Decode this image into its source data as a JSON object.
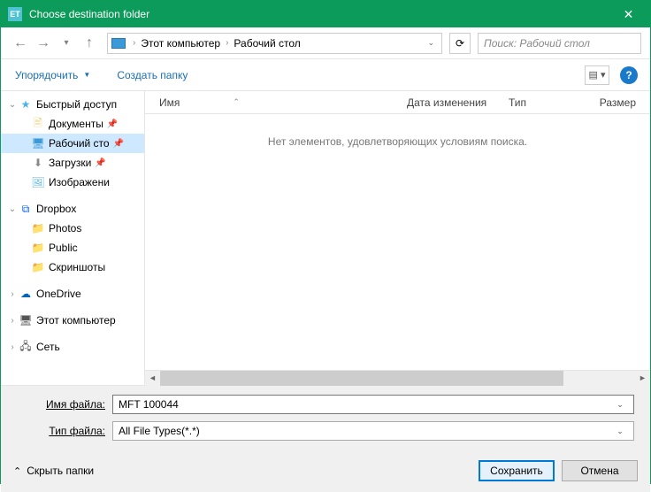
{
  "titlebar": {
    "title": "Choose destination folder"
  },
  "breadcrumb": {
    "item1": "Этот компьютер",
    "item2": "Рабочий стол"
  },
  "search": {
    "placeholder": "Поиск: Рабочий стол"
  },
  "toolbar": {
    "organize": "Упорядочить",
    "new_folder": "Создать папку"
  },
  "sidebar": {
    "quick_access": "Быстрый доступ",
    "documents": "Документы",
    "desktop": "Рабочий сто",
    "downloads": "Загрузки",
    "images": "Изображени",
    "dropbox": "Dropbox",
    "photos": "Photos",
    "public": "Public",
    "screenshots": "Скриншоты",
    "onedrive": "OneDrive",
    "this_pc": "Этот компьютер",
    "network": "Сеть"
  },
  "columns": {
    "name": "Имя",
    "date": "Дата изменения",
    "type": "Тип",
    "size": "Размер"
  },
  "empty_message": "Нет элементов, удовлетворяющих условиям поиска.",
  "fields": {
    "filename_label": "Имя файла:",
    "filename_value": "MFT 100044",
    "filetype_label": "Тип файла:",
    "filetype_value": "All File Types(*.*)"
  },
  "footer": {
    "hide_folders": "Скрыть папки",
    "save": "Сохранить",
    "cancel": "Отмена"
  }
}
